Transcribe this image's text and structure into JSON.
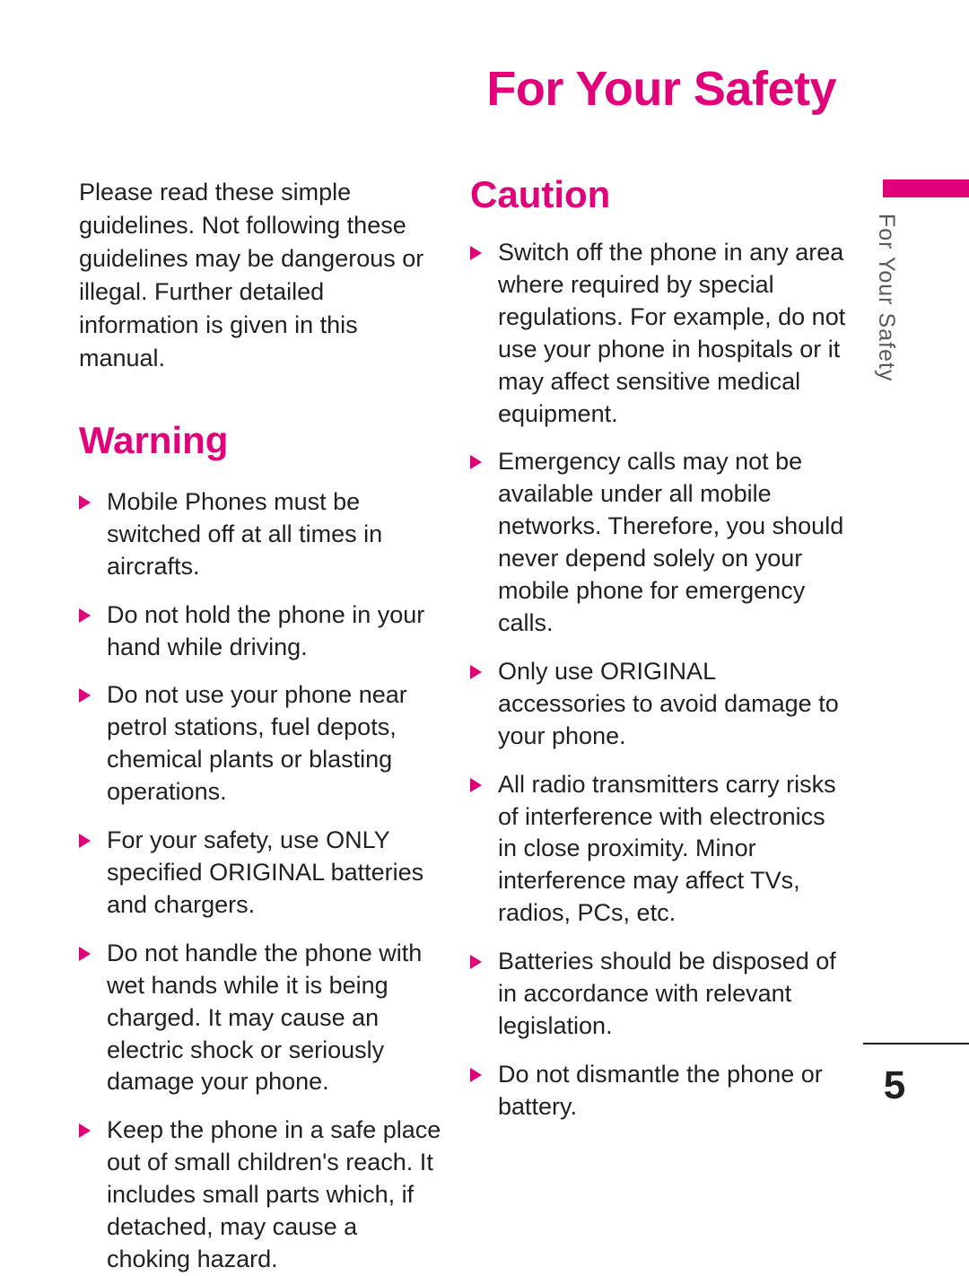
{
  "header": {
    "title": "For Your Safety"
  },
  "side_tab": {
    "label": "For Your Safety"
  },
  "left_column": {
    "intro": "Please read these simple guidelines. Not following these guidelines may be dangerous or illegal. Further detailed information is given in this manual.",
    "warning_heading": "Warning",
    "warning_items": [
      "Mobile Phones must be switched off at all times in aircrafts.",
      "Do not hold the phone in your hand while driving.",
      "Do not use your phone near petrol stations, fuel depots, chemical plants or blasting operations.",
      "For your safety, use ONLY specified ORIGINAL batteries and chargers.",
      "Do not handle the phone with wet hands while it is being charged. It may cause an electric shock or seriously damage your phone.",
      "Keep the phone in a safe place out of small children's reach. It includes small parts which, if detached, may cause a choking hazard."
    ]
  },
  "right_column": {
    "caution_heading": "Caution",
    "caution_items": [
      "Switch off the phone in any area where required by special regulations. For example, do not use your phone in hospitals or it may affect sensitive medical equipment.",
      "Emergency calls may not be available under all mobile networks. Therefore, you should never depend solely on your mobile phone for emergency calls.",
      "Only use ORIGINAL accessories to avoid damage to your phone.",
      "All radio transmitters carry risks of interference with electronics in close proximity. Minor interference may affect TVs, radios, PCs, etc.",
      "Batteries should be disposed of in accordance with relevant legislation.",
      "Do not dismantle the phone or battery."
    ]
  },
  "footer": {
    "page_number": "5"
  },
  "colors": {
    "accent": "#e2007a",
    "text": "#231f20",
    "tab_text": "#58595b"
  }
}
